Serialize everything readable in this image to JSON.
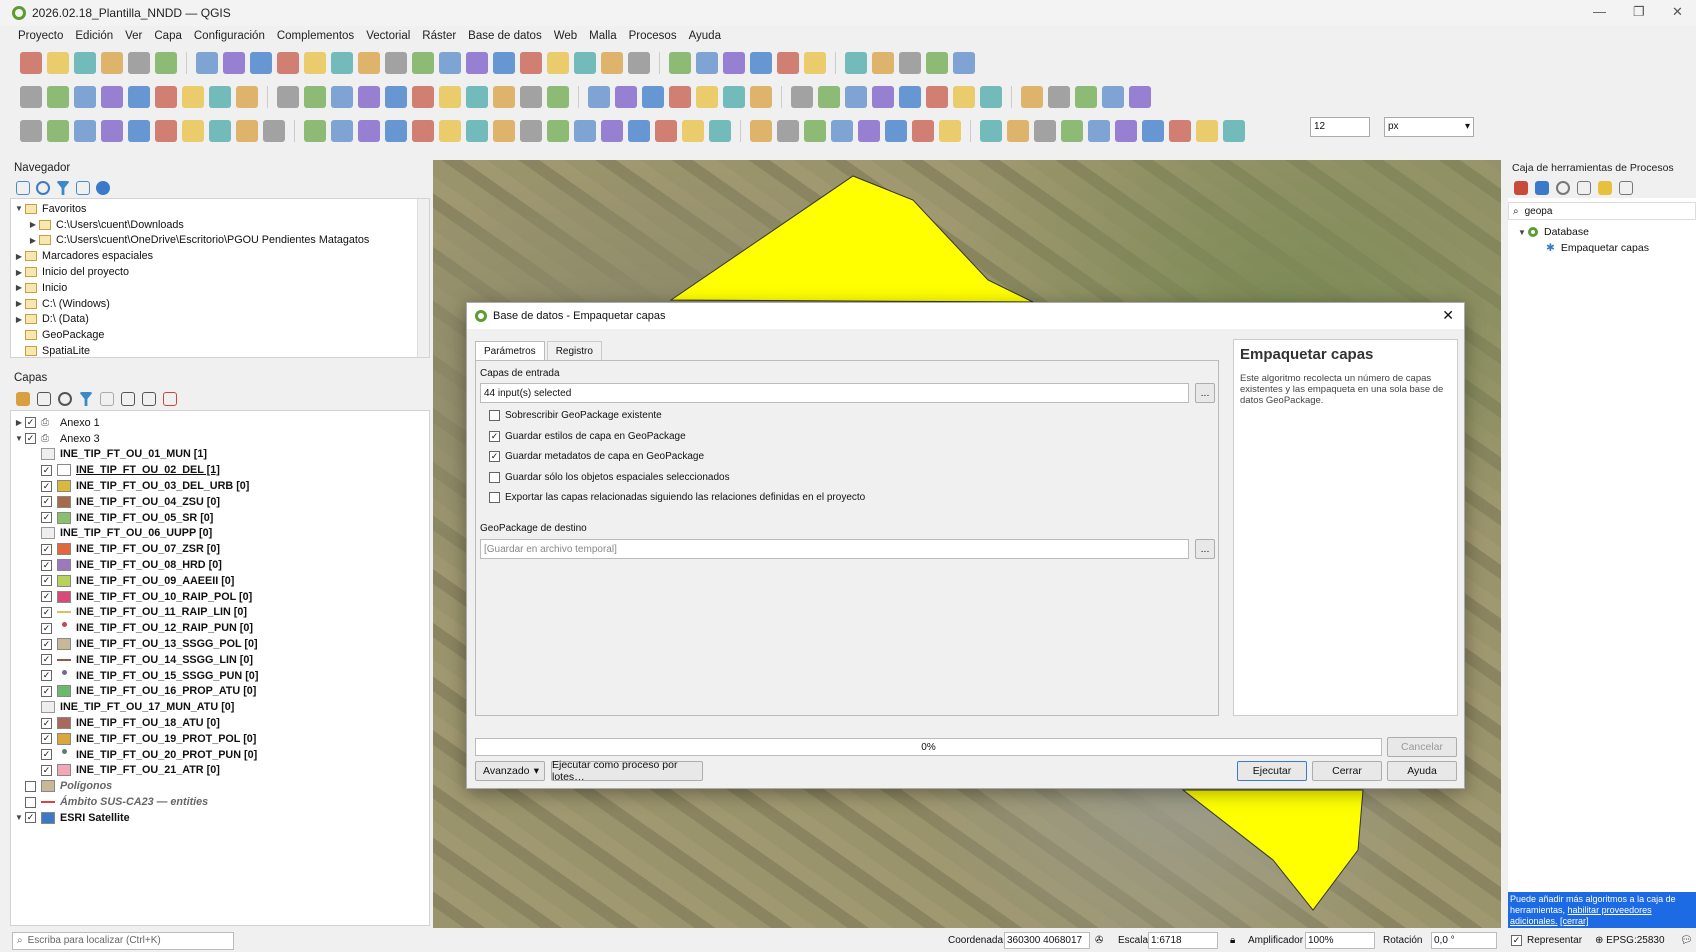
{
  "window": {
    "title": "2026.02.18_Plantilla_NNDD — QGIS"
  },
  "menu": [
    "Proyecto",
    "Edición",
    "Ver",
    "Capa",
    "Configuración",
    "Complementos",
    "Vectorial",
    "Ráster",
    "Base de datos",
    "Web",
    "Malla",
    "Procesos",
    "Ayuda"
  ],
  "browser": {
    "title": "Navegador",
    "items": [
      {
        "label": "Favoritos",
        "level": 0,
        "expand": "▼"
      },
      {
        "label": "C:\\Users\\cuent\\Downloads",
        "level": 1,
        "expand": "▶"
      },
      {
        "label": "C:\\Users\\cuent\\OneDrive\\Escritorio\\PGOU Pendientes Matagatos",
        "level": 1,
        "expand": "▶"
      },
      {
        "label": "Marcadores espaciales",
        "level": 0,
        "expand": "▶"
      },
      {
        "label": "Inicio del proyecto",
        "level": 0,
        "expand": "▶"
      },
      {
        "label": "Inicio",
        "level": 0,
        "expand": "▶"
      },
      {
        "label": "C:\\ (Windows)",
        "level": 0,
        "expand": "▶"
      },
      {
        "label": "D:\\ (Data)",
        "level": 0,
        "expand": "▶"
      },
      {
        "label": "GeoPackage",
        "level": 0,
        "expand": ""
      },
      {
        "label": "SpatiaLite",
        "level": 0,
        "expand": ""
      }
    ]
  },
  "layers": {
    "title": "Capas",
    "items": [
      {
        "label": "Anexo 1",
        "group": true,
        "checked": true,
        "expand": "▶"
      },
      {
        "label": "Anexo 3",
        "group": true,
        "checked": true,
        "expand": "▼"
      },
      {
        "label": "INE_TIP_FT_OU_01_MUN [1]",
        "table": true
      },
      {
        "label": "INE_TIP_FT_OU_02_DEL [1]",
        "checked": true,
        "color": "#ffffff",
        "underline": true
      },
      {
        "label": "INE_TIP_FT_OU_03_DEL_URB [0]",
        "checked": true,
        "color": "#d8b93c"
      },
      {
        "label": "INE_TIP_FT_OU_04_ZSU [0]",
        "checked": true,
        "color": "#a86a4c"
      },
      {
        "label": "INE_TIP_FT_OU_05_SR [0]",
        "checked": true,
        "color": "#8cbf6c"
      },
      {
        "label": "INE_TIP_FT_OU_06_UUPP [0]",
        "table": true
      },
      {
        "label": "INE_TIP_FT_OU_07_ZSR [0]",
        "checked": true,
        "color": "#e0683c"
      },
      {
        "label": "INE_TIP_FT_OU_08_HRD [0]",
        "checked": true,
        "color": "#9c78c0"
      },
      {
        "label": "INE_TIP_FT_OU_09_AAEEII [0]",
        "checked": true,
        "color": "#b8d05c"
      },
      {
        "label": "INE_TIP_FT_OU_10_RAIP_POL [0]",
        "checked": true,
        "color": "#d84878"
      },
      {
        "label": "INE_TIP_FT_OU_11_RAIP_LIN [0]",
        "checked": true,
        "line": "#d8c06c"
      },
      {
        "label": "INE_TIP_FT_OU_12_RAIP_PUN [0]",
        "checked": true,
        "dot": "#c04848"
      },
      {
        "label": "INE_TIP_FT_OU_13_SSGG_POL [0]",
        "checked": true,
        "color": "#c8b898"
      },
      {
        "label": "INE_TIP_FT_OU_14_SSGG_LIN [0]",
        "checked": true,
        "line": "#8c5c44"
      },
      {
        "label": "INE_TIP_FT_OU_15_SSGG_PUN [0]",
        "checked": true,
        "dot": "#6c6c9c"
      },
      {
        "label": "INE_TIP_FT_OU_16_PROP_ATU [0]",
        "checked": true,
        "color": "#6cb86c"
      },
      {
        "label": "INE_TIP_FT_OU_17_MUN_ATU [0]",
        "table": true
      },
      {
        "label": "INE_TIP_FT_OU_18_ATU [0]",
        "checked": true,
        "color": "#a8685c"
      },
      {
        "label": "INE_TIP_FT_OU_19_PROT_POL [0]",
        "checked": true,
        "color": "#d8a83c"
      },
      {
        "label": "INE_TIP_FT_OU_20_PROT_PUN [0]",
        "checked": true,
        "dot": "#5c7c6c"
      },
      {
        "label": "INE_TIP_FT_OU_21_ATR [0]",
        "checked": true,
        "color": "#f0a8b8"
      },
      {
        "label": "Polígonos",
        "top": true,
        "checked": false,
        "color": "#c8b898",
        "italic": true
      },
      {
        "label": "Ámbito SUS-CA23 — entities",
        "top": true,
        "checked": false,
        "line": "#e04040",
        "italic": true
      },
      {
        "label": "ESRI Satellite",
        "top": true,
        "checked": true,
        "expand": "▼",
        "raster": true
      }
    ]
  },
  "toolbar": {
    "snap_value": "12",
    "snap_unit": "px"
  },
  "dialog": {
    "title": "Base de datos - Empaquetar capas",
    "tabs": [
      "Parámetros",
      "Registro"
    ],
    "input_label": "Capas de entrada",
    "input_value": "44 input(s) selected",
    "checks": [
      {
        "label": "Sobrescribir GeoPackage existente",
        "checked": false
      },
      {
        "label": "Guardar estilos de capa en GeoPackage",
        "checked": true
      },
      {
        "label": "Guardar metadatos de capa en GeoPackage",
        "checked": true
      },
      {
        "label": "Guardar sólo los objetos espaciales seleccionados",
        "checked": false
      },
      {
        "label": "Exportar las capas relacionadas siguiendo las relaciones definidas en el proyecto",
        "checked": false
      }
    ],
    "dest_label": "GeoPackage de destino",
    "dest_placeholder": "[Guardar en archivo temporal]",
    "dots": "...",
    "help_title": "Empaquetar capas",
    "help_text": "Este algoritmo recolecta un número de capas existentes y las empaqueta en una sola base de datos GeoPackage.",
    "progress_text": "0%",
    "progress": 0,
    "cancel": "Cancelar",
    "advanced": "Avanzado",
    "batch": "Ejecutar como proceso por lotes…",
    "run": "Ejecutar",
    "close": "Cerrar",
    "help": "Ayuda"
  },
  "toolbox": {
    "title": "Caja de herramientas de Procesos",
    "search": "geopa",
    "group": "Database",
    "item": "Empaquetar capas",
    "note_text": "Puede añadir más algoritmos a la caja de herramientas,",
    "note_link": "habilitar proveedores adicionales.",
    "note_close": "[cerrar]"
  },
  "status": {
    "search_placeholder": "Escriba para localizar (Ctrl+K)",
    "coord_label": "Coordenada",
    "coord": "360300 4068017",
    "scale_label": "Escala",
    "scale": "1:6718",
    "mag_label": "Amplificador",
    "mag": "100%",
    "rot_label": "Rotación",
    "rot": "0,0 °",
    "render": "Representar",
    "crs": "EPSG:25830"
  }
}
